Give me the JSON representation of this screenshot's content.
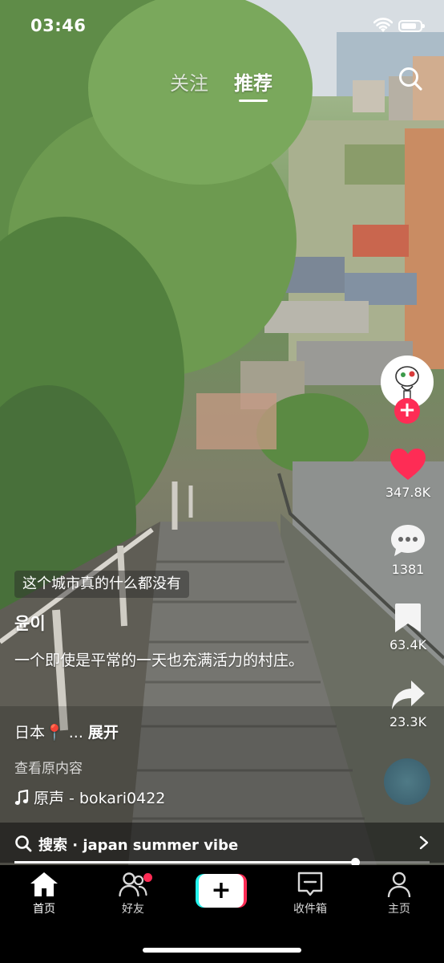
{
  "status_bar": {
    "time": "03:46"
  },
  "top_tabs": {
    "following": "关注",
    "recommended": "推荐"
  },
  "actions": {
    "likes": "347.8K",
    "comments": "1381",
    "favorites": "63.4K",
    "shares": "23.3K"
  },
  "post": {
    "location_tag": "这个城市真的什么都没有",
    "author": "윤이",
    "description": "一个即使是平常的一天也充满活力的村庄。",
    "location": "日本",
    "pin_icon": "📍",
    "ellipsis": "...",
    "expand_label": "展开",
    "view_original": "查看原内容",
    "sound": "原声 - bokari0422"
  },
  "search_suggestion": {
    "text": "搜索 · japan summer vibe"
  },
  "progress": {
    "played_fraction": 0.82
  },
  "bottom_nav": {
    "home": "首页",
    "friends": "好友",
    "inbox": "收件箱",
    "me": "主页"
  },
  "colors": {
    "accent_red": "#fe2c55",
    "accent_cyan": "#25f4ee",
    "music_disc": "#4f7a86"
  },
  "icons": {
    "wifi": "wifi-icon",
    "battery": "battery-icon",
    "search": "search-icon",
    "like": "heart-icon",
    "comment": "comment-bubble-icon",
    "favorite": "bookmark-icon",
    "share": "share-arrow-icon",
    "home": "home-icon",
    "friends": "friends-icon",
    "create": "plus-icon",
    "inbox": "inbox-icon",
    "me": "person-icon"
  }
}
